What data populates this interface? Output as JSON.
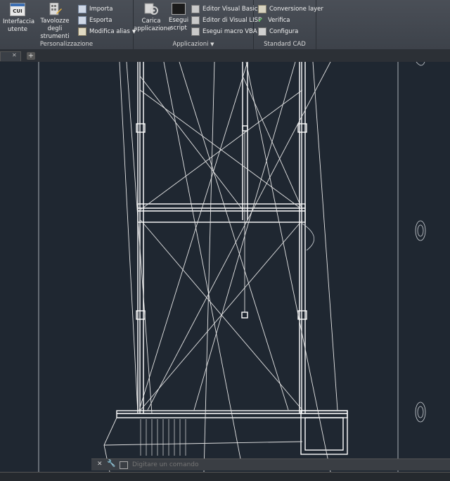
{
  "ribbon": {
    "personalizzazione": {
      "title": "Personalizzazione",
      "interfaccia_label1": "Interfaccia",
      "interfaccia_label2": "utente",
      "tavolozze_label1": "Tavolozze degli",
      "tavolozze_label2": "strumenti",
      "importa": "Importa",
      "esporta": "Esporta",
      "modifica_alias": "Modifica alias",
      "cui_icon_text": "CUI"
    },
    "applicazioni": {
      "title": "Applicazioni",
      "carica_label1": "Carica",
      "carica_label2": "applicazione",
      "esegui_label1": "Esegui",
      "esegui_label2": "script",
      "editor_vb": "Editor Visual Basic",
      "editor_lisp": "Editor di Visual LISP",
      "esegui_macro": "Esegui macro VBA"
    },
    "standard_cad": {
      "title": "Standard CAD",
      "conversione": "Conversione layer",
      "verifica": "Verifica",
      "configura": "Configura"
    }
  },
  "tabs": {
    "close_symbol": "✕",
    "add_symbol": "+"
  },
  "command_line": {
    "placeholder": "Digitare un comando"
  },
  "colors": {
    "ribbon_bg": "#42474f",
    "canvas_bg": "#1f2731",
    "drawing_line": "#ffffff"
  }
}
